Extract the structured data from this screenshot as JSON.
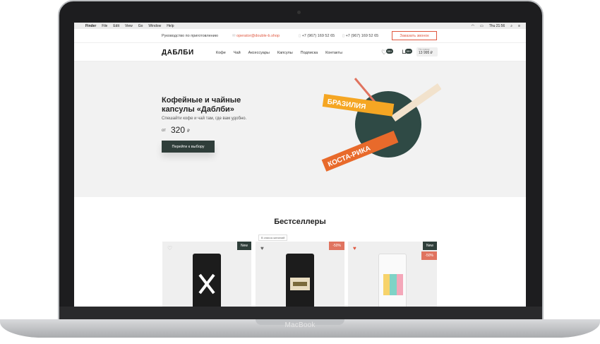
{
  "device": {
    "brand": "MacBook"
  },
  "menubar": {
    "apple": "",
    "items": [
      "Finder",
      "File",
      "Edit",
      "View",
      "Go",
      "Window",
      "Help"
    ],
    "clock": "Thu 21:56"
  },
  "topbar": {
    "guide": "Руководство по приготовлению",
    "email": "operator@double-b.shop",
    "phone1": "+7 (967) 169 52 65",
    "phone2": "+7 (967) 169 52 65",
    "call_button": "Заказать звонок"
  },
  "nav": {
    "logo": "ДАБЛБИ",
    "links": [
      "Кофе",
      "Чай",
      "Аксессуары",
      "Капсулы",
      "Подписка",
      "Контакты"
    ],
    "favorites_count": "99+",
    "cart_count": "99+",
    "sum_label": "На сумму",
    "sum_value": "13 995 ₽"
  },
  "hero": {
    "title": "Кофейные и чайные капсулы «Даблби»",
    "subtitle": "Спешайти кофе и чай там, где вам удобно.",
    "price_prefix": "от",
    "price": "320",
    "currency": "₽",
    "button": "Перейти к выбору",
    "art_labels": [
      "БРАЗИЛИЯ",
      "КОСТА-РИКА"
    ]
  },
  "bestsellers": {
    "title": "Бестселлеры",
    "tooltip": "В список желаний",
    "cards": [
      {
        "tag": "New",
        "tag_type": "new"
      },
      {
        "tag": "-50%",
        "tag_type": "sale"
      },
      {
        "tag": "New",
        "tag_type": "new",
        "tag2": "-50%"
      }
    ]
  },
  "colors": {
    "accent": "#e0573f",
    "dark": "#2f3e3a",
    "hero_bg": "#f2f2f2"
  }
}
